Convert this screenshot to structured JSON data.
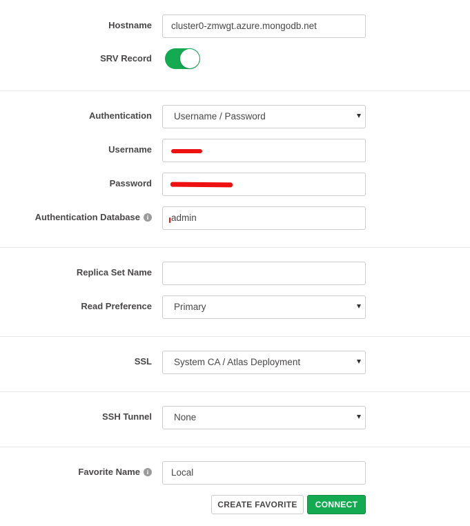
{
  "colors": {
    "accent": "#13aa52",
    "redaction": "#ee1111"
  },
  "hostname": {
    "label": "Hostname",
    "value": "cluster0-zmwgt.azure.mongodb.net"
  },
  "srv_record": {
    "label": "SRV Record",
    "enabled": true
  },
  "authentication": {
    "label": "Authentication",
    "selected": "Username / Password"
  },
  "username": {
    "label": "Username",
    "value": ""
  },
  "password": {
    "label": "Password",
    "value": ""
  },
  "auth_database": {
    "label": "Authentication Database",
    "info_icon": "info-circle-icon",
    "value": "admin"
  },
  "replica_set": {
    "label": "Replica Set Name",
    "value": ""
  },
  "read_preference": {
    "label": "Read Preference",
    "selected": "Primary"
  },
  "ssl": {
    "label": "SSL",
    "selected": "System CA / Atlas Deployment"
  },
  "ssh_tunnel": {
    "label": "SSH Tunnel",
    "selected": "None"
  },
  "favorite_name": {
    "label": "Favorite Name",
    "info_icon": "info-circle-icon",
    "value": "Local"
  },
  "buttons": {
    "create_favorite": "CREATE FAVORITE",
    "connect": "CONNECT"
  }
}
